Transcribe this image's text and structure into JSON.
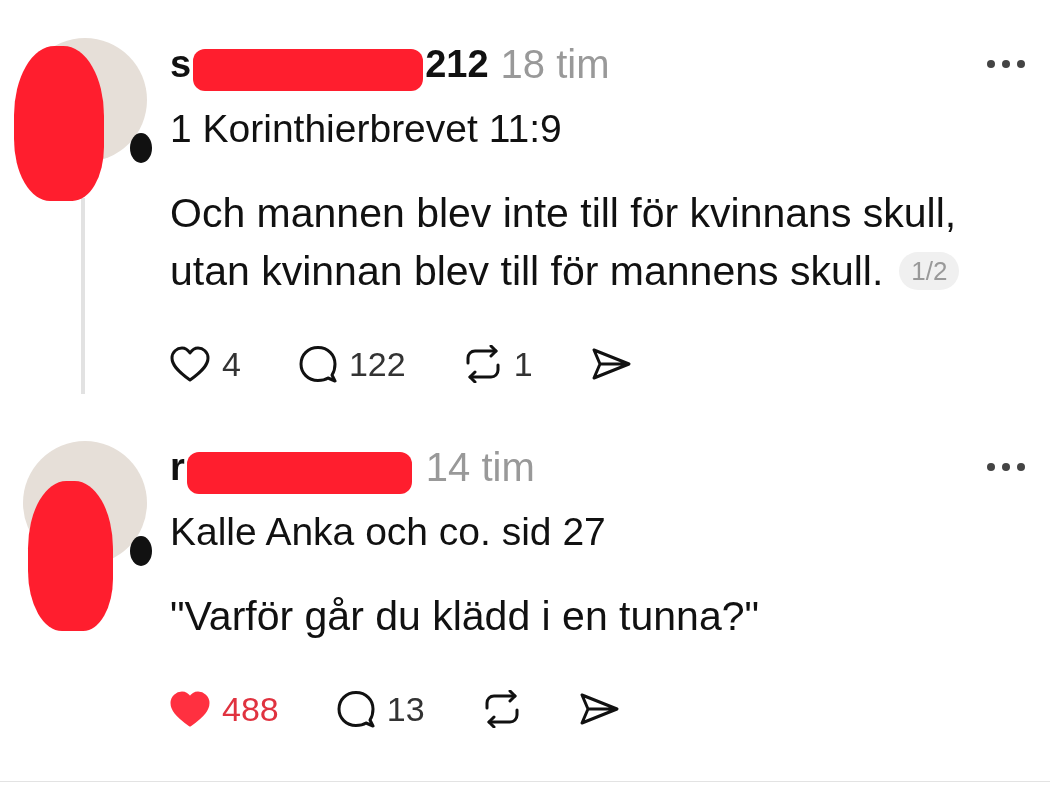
{
  "posts": [
    {
      "username": [
        {
          "kind": "text",
          "text": "s"
        },
        {
          "kind": "redacted"
        },
        {
          "kind": "text",
          "text": "212"
        }
      ],
      "time": "18 tim",
      "reference": "1 Korinthierbrevet 11:9",
      "body_lines": [
        "Och mannen blev inte till för kvinnans skull,",
        "utan kvinnan blev till för mannens skull."
      ],
      "page_counter": "1/2",
      "thread_line": true,
      "likes": {
        "count": "4",
        "liked": false
      },
      "comments": "122",
      "reposts": "1"
    },
    {
      "username": [
        {
          "kind": "text",
          "text": "r"
        },
        {
          "kind": "redacted"
        }
      ],
      "time": "14 tim",
      "reference": "Kalle Anka och co. sid 27",
      "body_lines": [
        "\"Varför går du klädd i en tunna?\""
      ],
      "thread_line": false,
      "likes": {
        "count": "488",
        "liked": true
      },
      "comments": "13"
    }
  ]
}
